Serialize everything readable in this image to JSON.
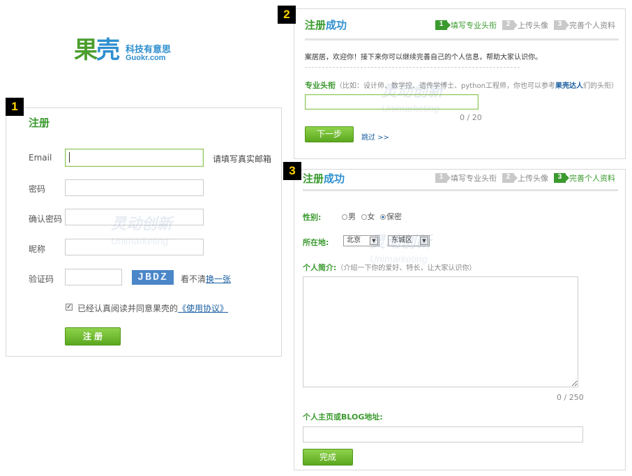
{
  "badges": [
    "1",
    "2",
    "3"
  ],
  "logo": {
    "main_a": "果",
    "main_b": "壳",
    "cn": "科技有意思",
    "en": "Guokr.com"
  },
  "watermark": {
    "cn": "灵动创新",
    "en": "Unimarketing"
  },
  "register": {
    "title": "注册",
    "email_label": "Email",
    "email_hint": "请填写真实邮箱",
    "password_label": "密码",
    "confirm_label": "确认密码",
    "nickname_label": "昵称",
    "captcha_label": "验证码",
    "captcha_text": "JBDZ",
    "captcha_unclear": "看不清",
    "captcha_change": "换一张",
    "agree_text": "已经认真阅读并同意果壳的",
    "agree_link": "《使用协议》",
    "submit": "注 册"
  },
  "step2": {
    "title_a": "注册",
    "title_b": "成功",
    "steps": [
      {
        "num": "1",
        "label": "填写专业头衔",
        "active": true
      },
      {
        "num": "2",
        "label": "上传头像",
        "active": false
      },
      {
        "num": "3",
        "label": "完善个人资料",
        "active": false
      }
    ],
    "welcome": "案居居，欢迎你！接下来你可以继续完善自己的个人信息，帮助大家认识你。",
    "field_label": "专业头衔",
    "field_hint_a": "（比如：设计师、数学控、遗传学博士、python工程师，你也可以参考",
    "field_hint_link": "果壳达人",
    "field_hint_b": "们的头衔）",
    "counter": "0 / 20",
    "next": "下一步",
    "skip": "跳过 >>"
  },
  "step3": {
    "title_a": "注册",
    "title_b": "成功",
    "steps": [
      {
        "num": "1",
        "label": "填写专业头衔",
        "active": false
      },
      {
        "num": "2",
        "label": "上传头像",
        "active": false
      },
      {
        "num": "3",
        "label": "完善个人资料",
        "active": true
      }
    ],
    "gender_label": "性别:",
    "gender_options": [
      "男",
      "女",
      "保密"
    ],
    "location_label": "所在地:",
    "city": "北京",
    "district": "东城区",
    "bio_label": "个人简介:",
    "bio_hint": "（介绍一下你的爱好、特长，让大家认识你）",
    "bio_counter": "0 / 250",
    "blog_label": "个人主页或BLOG地址:",
    "done": "完成"
  }
}
